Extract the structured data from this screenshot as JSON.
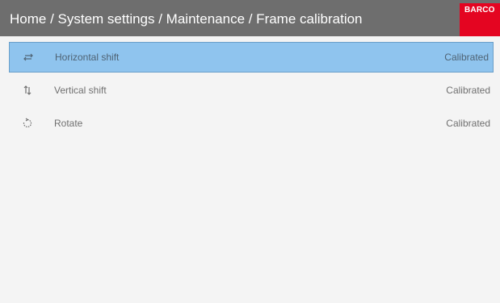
{
  "header": {
    "breadcrumb": "Home / System settings / Maintenance / Frame calibration",
    "logo_text": "BARCO"
  },
  "menu": {
    "items": [
      {
        "label": "Horizontal shift",
        "status": "Calibrated",
        "icon": "horizontal-shift-icon",
        "selected": true
      },
      {
        "label": "Vertical shift",
        "status": "Calibrated",
        "icon": "vertical-shift-icon",
        "selected": false
      },
      {
        "label": "Rotate",
        "status": "Calibrated",
        "icon": "rotate-icon",
        "selected": false
      }
    ]
  },
  "colors": {
    "header_bg": "#6e6e6e",
    "logo_bg": "#e40521",
    "selection_bg": "#8fc4ee",
    "page_bg": "#f4f4f4"
  }
}
